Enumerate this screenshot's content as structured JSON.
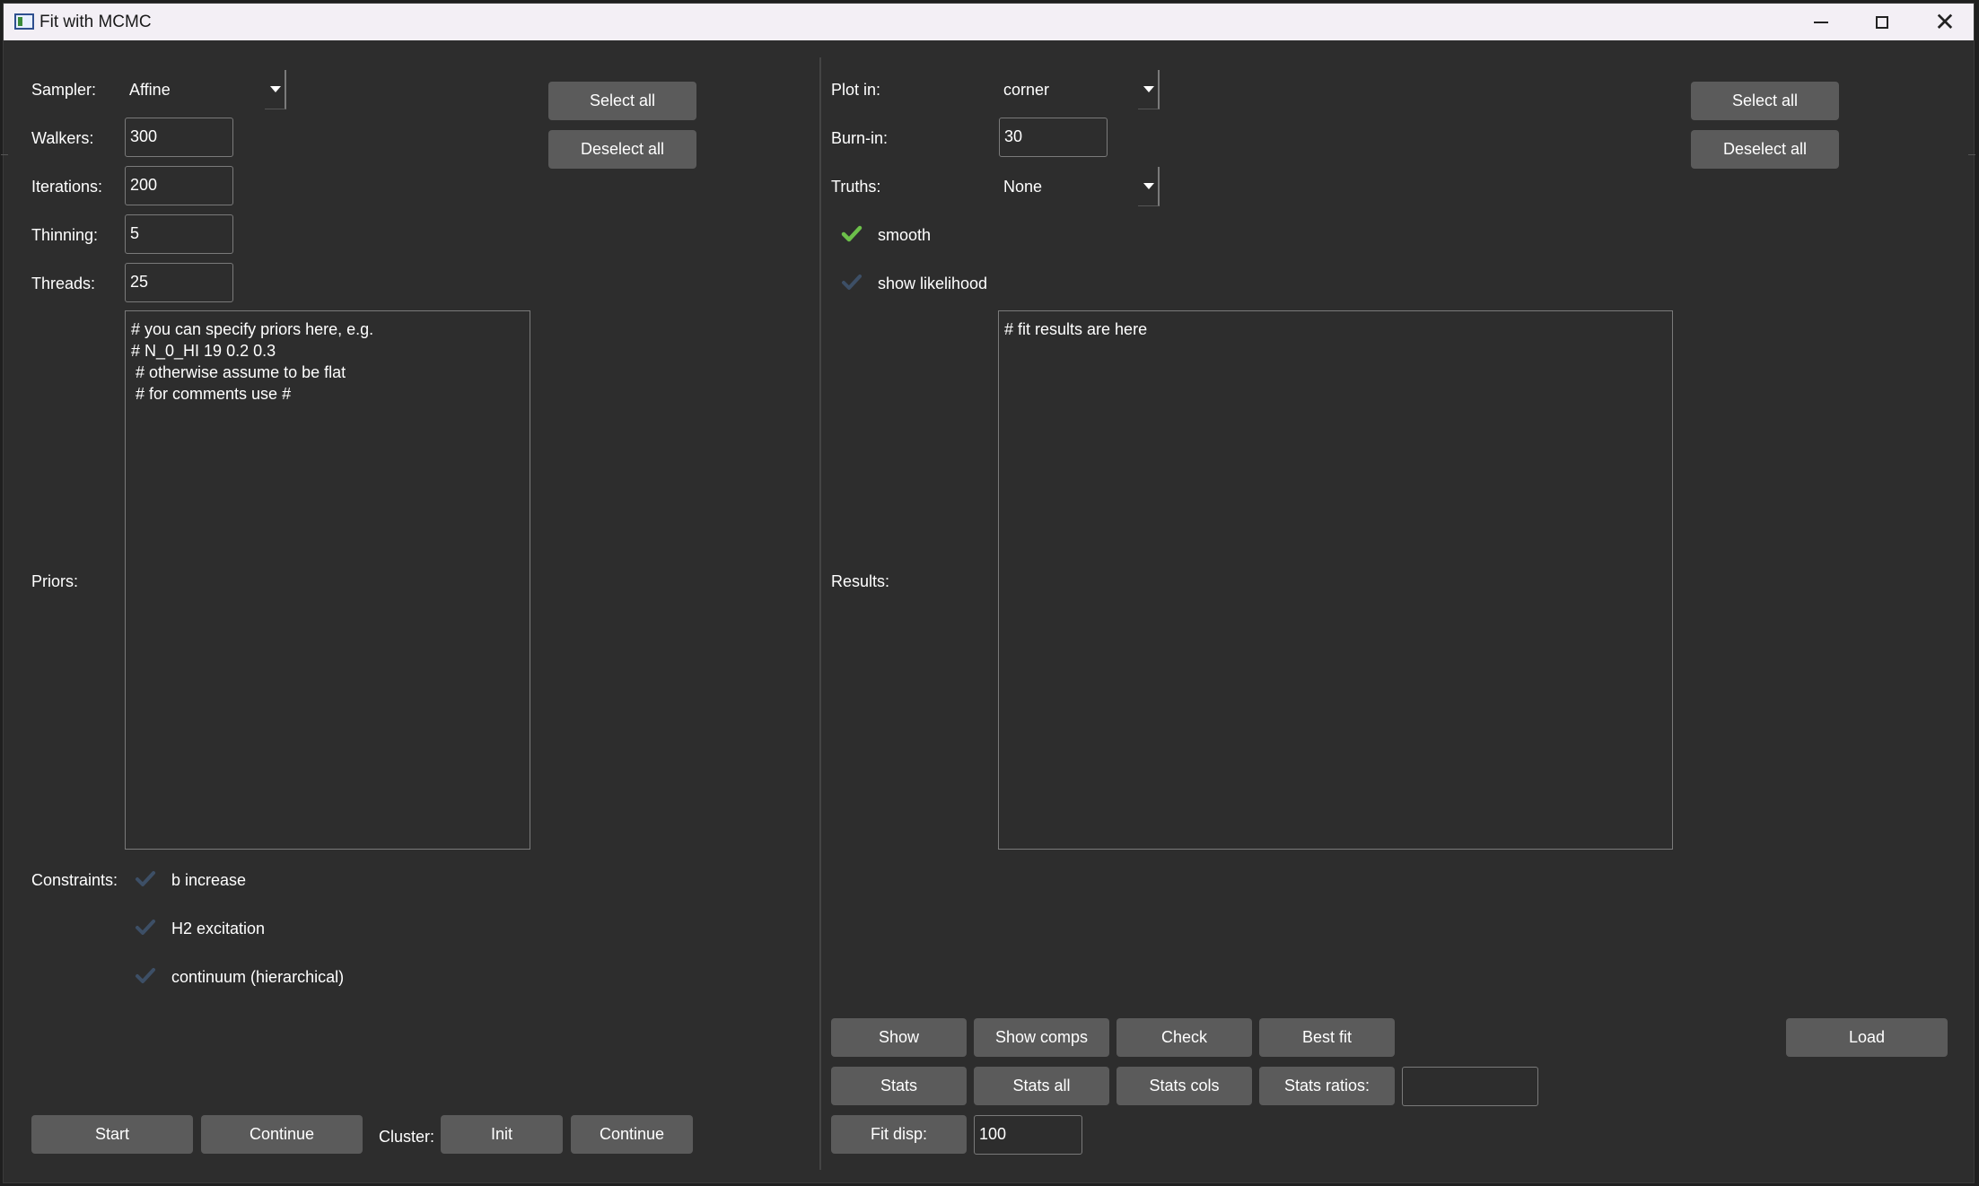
{
  "window": {
    "title": "Fit with MCMC"
  },
  "left": {
    "sampler_label": "Sampler:",
    "sampler_value": "Affine",
    "walkers_label": "Walkers:",
    "walkers_value": "300",
    "iterations_label": "Iterations:",
    "iterations_value": "200",
    "thinning_label": "Thinning:",
    "thinning_value": "5",
    "threads_label": "Threads:",
    "threads_value": "25",
    "select_all": "Select all",
    "deselect_all": "Deselect all",
    "priors_label": "Priors:",
    "priors_text": "# you can specify priors here, e.g.\n# N_0_HI 19 0.2 0.3\n # otherwise assume to be flat\n # for comments use #",
    "constraints_label": "Constraints:",
    "constraints": [
      {
        "label": "b increase",
        "checked": false
      },
      {
        "label": "H2 excitation",
        "checked": false
      },
      {
        "label": "continuum (hierarchical)",
        "checked": false
      }
    ],
    "start": "Start",
    "continue": "Continue",
    "cluster_label": "Cluster:",
    "init": "Init",
    "cluster_continue": "Continue"
  },
  "right": {
    "plot_in_label": "Plot in:",
    "plot_in_value": "corner",
    "burn_in_label": "Burn-in:",
    "burn_in_value": "30",
    "truths_label": "Truths:",
    "truths_value": "None",
    "smooth_label": "smooth",
    "smooth_checked": true,
    "show_likelihood_label": "show likelihood",
    "show_likelihood_checked": false,
    "select_all": "Select all",
    "deselect_all": "Deselect all",
    "results_label": "Results:",
    "results_text": "# fit results are here",
    "buttons_row1": [
      "Show",
      "Show comps",
      "Check",
      "Best fit"
    ],
    "load": "Load",
    "buttons_row2": [
      "Stats",
      "Stats all",
      "Stats cols",
      "Stats ratios:"
    ],
    "stats_ratios_value": "",
    "fit_disp_label": "Fit disp:",
    "fit_disp_value": "100"
  },
  "colors": {
    "background": "#2d2d2d",
    "button": "#5b5b5b",
    "check_on": "#6cc04a",
    "check_off": "#3d4f66"
  }
}
